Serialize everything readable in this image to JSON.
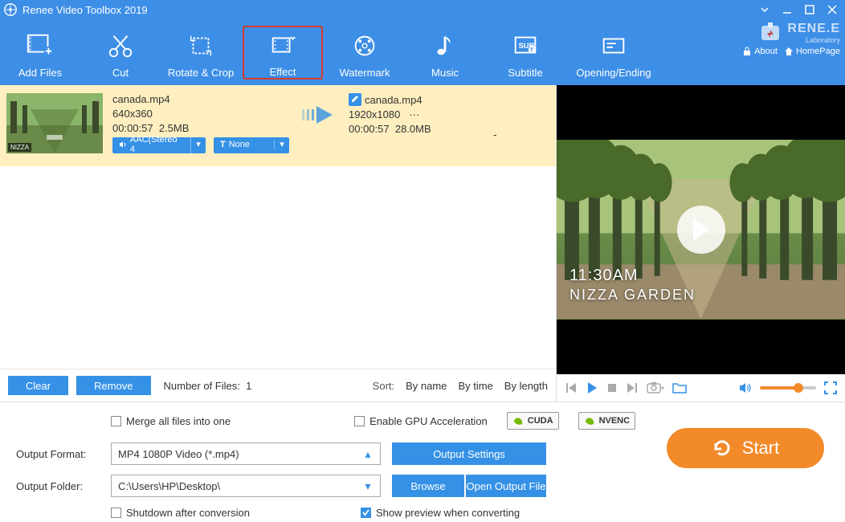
{
  "titlebar": {
    "title": "Renee Video Toolbox 2019"
  },
  "brand": {
    "name": "RENE.E",
    "sub": "Laboratory",
    "about": "About",
    "home": "HomePage"
  },
  "toolbar": {
    "add": "Add Files",
    "cut": "Cut",
    "rotate": "Rotate & Crop",
    "effect": "Effect",
    "watermark": "Watermark",
    "music": "Music",
    "subtitle": "Subtitle",
    "opening": "Opening/Ending"
  },
  "file": {
    "src_name": "canada.mp4",
    "src_res": "640x360",
    "src_time": "00:00:57",
    "src_size": "2.5MB",
    "dst_name": "canada.mp4",
    "dst_res": "1920x1080",
    "dst_dots": "···",
    "dst_time": "00:00:57",
    "dst_size": "28.0MB",
    "thumb_label": "NIZZA",
    "audio_chip": "AAC(Stereo 4",
    "sub_chip": "None",
    "dash": "-"
  },
  "listfoot": {
    "clear": "Clear",
    "remove": "Remove",
    "count_label": "Number of Files:",
    "count": "1",
    "sort_label": "Sort:",
    "s1": "By name",
    "s2": "By time",
    "s3": "By length"
  },
  "overlay": {
    "t1": "11:30AM",
    "t2": "NIZZA GARDEN"
  },
  "bottom": {
    "merge": "Merge all files into one",
    "gpu": "Enable GPU Acceleration",
    "cuda": "CUDA",
    "nvenc": "NVENC",
    "out_fmt_label": "Output Format:",
    "out_fmt_value": "MP4 1080P Video (*.mp4)",
    "out_settings": "Output Settings",
    "out_folder_label": "Output Folder:",
    "out_folder_value": "C:\\Users\\HP\\Desktop\\",
    "browse": "Browse",
    "open_folder": "Open Output File",
    "shutdown": "Shutdown after conversion",
    "preview": "Show preview when converting",
    "start": "Start"
  }
}
